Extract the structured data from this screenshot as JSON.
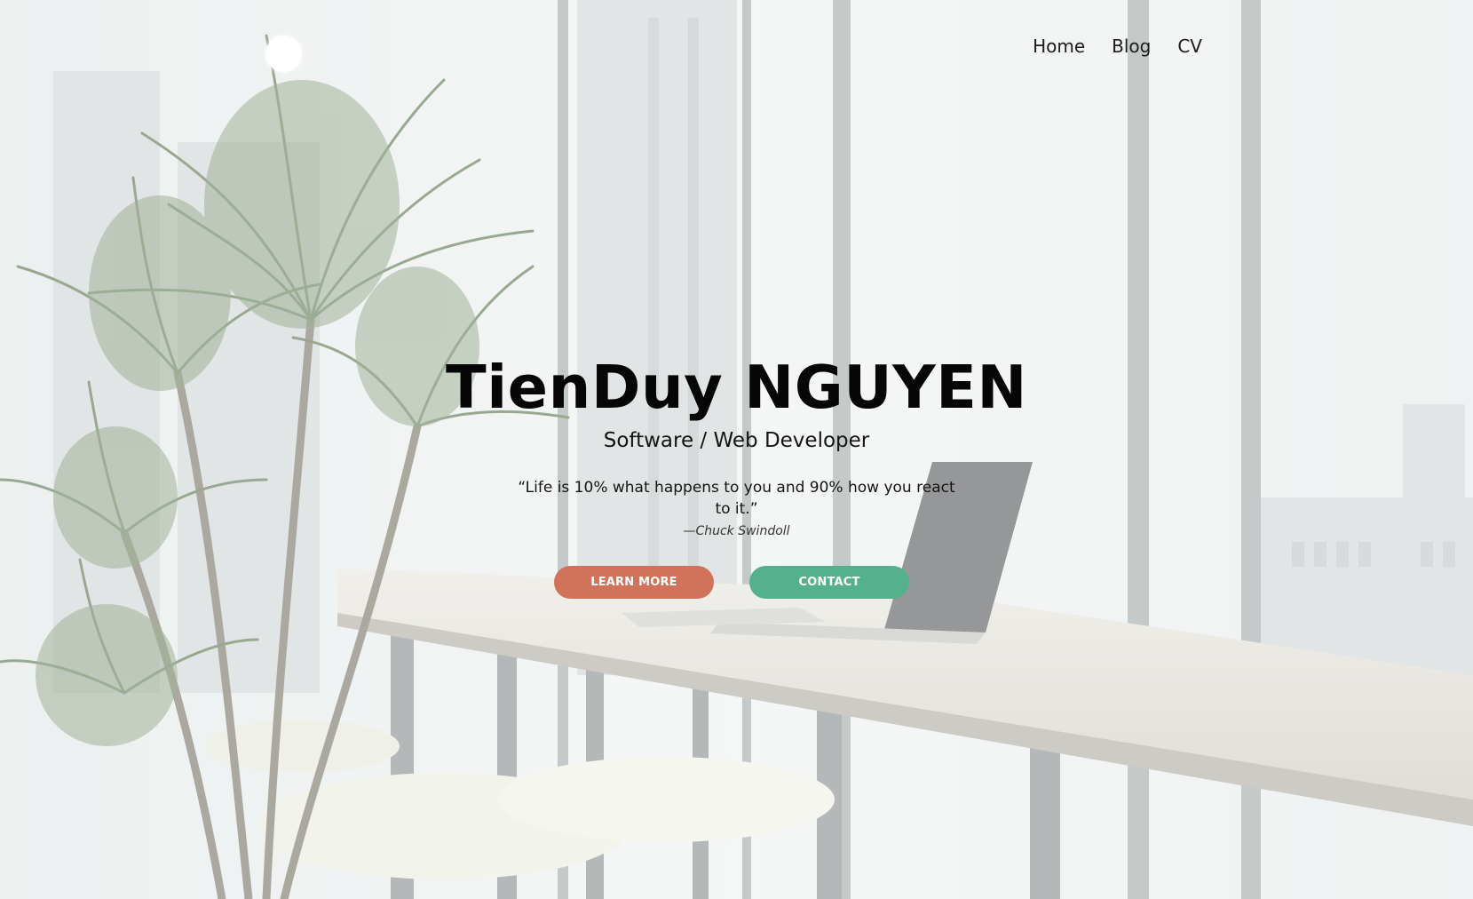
{
  "nav": {
    "items": [
      {
        "label": "Home"
      },
      {
        "label": "Blog"
      },
      {
        "label": "CV"
      }
    ]
  },
  "hero": {
    "name": "TienDuy NGUYEN",
    "role": "Software / Web Developer",
    "quote": "“Life is 10% what happens to you and 90% how you react to it.”",
    "quote_author": "—Chuck Swindoll",
    "learn_more_label": "LEARN MORE",
    "contact_label": "CONTACT"
  },
  "colors": {
    "learn_more_button": "#d1735a",
    "contact_button": "#55b08e",
    "logo": "#ffffff"
  }
}
